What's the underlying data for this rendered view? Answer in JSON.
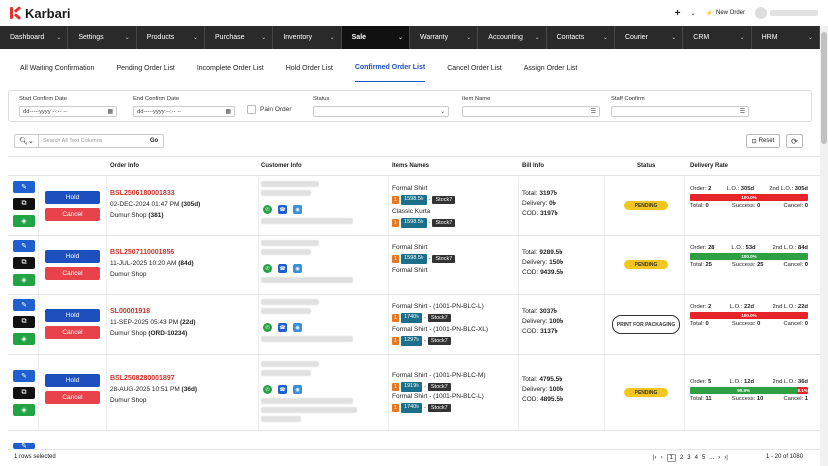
{
  "app": {
    "name": "Karbari"
  },
  "topbar": {
    "plus": "+",
    "new_order": "New Order"
  },
  "nav": [
    "Dashboard",
    "Settings",
    "Products",
    "Purchase",
    "Inventory",
    "Sale",
    "Warranty",
    "Accounting",
    "Contacts",
    "Courier",
    "CRM",
    "HRM"
  ],
  "nav_active": "Sale",
  "tabs": [
    "All Waiting Confirmation",
    "Pending Order List",
    "Incomplete Order List",
    "Hold Order List",
    "Confirmed Order List",
    "Cancel Order List",
    "Assign Order List"
  ],
  "tab_active": "Confirmed Order List",
  "filters": {
    "start_confirm_label": "Start Confirm Date",
    "start_confirm_value": "dd-----yyyy --:-- --",
    "end_confirm_label": "End Confirm Date",
    "end_confirm_value": "dd-----yyyy --:-- --",
    "pain_order_label": "Pain Order",
    "status_label": "Status",
    "item_name_label": "Item Name",
    "staff_confirm_label": "Staff Confirm"
  },
  "search": {
    "placeholder": "Search All Text Columns",
    "go": "Go"
  },
  "reset": "Reset",
  "table_headers": {
    "order_info": "Order Info",
    "customer_info": "Customer Info",
    "items_names": "Items Names",
    "bill_info": "Bill Info",
    "status": "Status",
    "delivery_rate": "Delivery Rate"
  },
  "rows": [
    {
      "hold": "Hold",
      "cancel": "Cancel",
      "order_id": "BSL2506180001833",
      "date": "02-DEC-2024 01:47 PM",
      "days": "(305d)",
      "shop": "Dumur Shop",
      "shop_ref": "(381)",
      "items": [
        {
          "name": "Formal Shirt",
          "qty": "1",
          "price": "1598.5৳",
          "stock": "Stock7"
        },
        {
          "name": "Classic Kurta",
          "qty": "1",
          "price": "1598.5৳",
          "stock": "Stock7"
        }
      ],
      "bill": {
        "total_label": "Total:",
        "total": "3197৳",
        "delivery_label": "Delivery:",
        "delivery": "0৳",
        "cod_label": "COD:",
        "cod": "3197৳"
      },
      "status": "PENDING",
      "delivery": {
        "order": "2",
        "lo": "305d",
        "lo2": "305d",
        "bars": [
          {
            "label": "100.0%",
            "fraction": 1.0,
            "color": "#e8242b"
          }
        ],
        "total": "0",
        "success": "0",
        "cancel": "0"
      }
    },
    {
      "hold": "Hold",
      "cancel": "Cancel",
      "order_id": "BSL2507110001856",
      "date": "11-JUL-2025 10:20 AM",
      "days": "(84d)",
      "shop": "Dumur Shop",
      "shop_ref": "",
      "items": [
        {
          "name": "Formal Shirt",
          "qty": "1",
          "price": "1598.5৳",
          "stock": "Stock7"
        },
        {
          "name": "Formal Shirt",
          "qty": "",
          "price": "",
          "stock": ""
        }
      ],
      "bill": {
        "total_label": "Total:",
        "total": "9289.5৳",
        "delivery_label": "Delivery:",
        "delivery": "150৳",
        "cod_label": "COD:",
        "cod": "9439.5৳"
      },
      "status": "PENDING",
      "delivery": {
        "order": "28",
        "lo": "53d",
        "lo2": "84d",
        "bars": [
          {
            "label": "100.0%",
            "fraction": 1.0,
            "color": "#2ea043"
          }
        ],
        "total": "25",
        "success": "25",
        "cancel": "0"
      }
    },
    {
      "hold": "Hold",
      "cancel": "Cancel",
      "order_id": "SL00001918",
      "date": "11-SEP-2025 05:43 PM",
      "days": "(22d)",
      "shop": "Dumur Shop",
      "shop_ref": "(ORD-10234)",
      "items": [
        {
          "name": "Formal Shirt - (1001-PN-BLC-L)",
          "qty": "1",
          "price": "1740৳",
          "stock": "Stock7"
        },
        {
          "name": "Formal Shirt - (1001-PN-BLC-XL)",
          "qty": "1",
          "price": "1297৳",
          "stock": "Stock7"
        }
      ],
      "bill": {
        "total_label": "Total:",
        "total": "3037৳",
        "delivery_label": "Delivery:",
        "delivery": "100৳",
        "cod_label": "COD:",
        "cod": "3137৳"
      },
      "status": "PRINT FOR PACKAGING",
      "delivery": {
        "order": "2",
        "lo": "22d",
        "lo2": "22d",
        "bars": [
          {
            "label": "100.0%",
            "fraction": 1.0,
            "color": "#e8242b"
          }
        ],
        "total": "0",
        "success": "0",
        "cancel": "0"
      }
    },
    {
      "hold": "Hold",
      "cancel": "Cancel",
      "order_id": "BSL2508280001897",
      "date": "28-AUG-2025 10:51 PM",
      "days": "(36d)",
      "shop": "Dumur Shop",
      "shop_ref": "",
      "items": [
        {
          "name": "Formal Shirt - (1001-PN-BLC-M)",
          "qty": "1",
          "price": "1919৳",
          "stock": "Stock7"
        },
        {
          "name": "Formal Shirt - (1001-PN-BLC-L)",
          "qty": "1",
          "price": "1740৳",
          "stock": "Stock7"
        }
      ],
      "bill": {
        "total_label": "Total:",
        "total": "4795.5৳",
        "delivery_label": "Delivery:",
        "delivery": "100৳",
        "cod_label": "COD:",
        "cod": "4895.5৳"
      },
      "status": "PENDING",
      "delivery": {
        "order": "5",
        "lo": "12d",
        "lo2": "36d",
        "bars": [
          {
            "label": "90.9%",
            "fraction": 0.909,
            "color": "#2ea043"
          },
          {
            "label": "9.1%",
            "fraction": 0.091,
            "color": "#e8242b"
          }
        ],
        "total": "11",
        "success": "10",
        "cancel": "1"
      }
    }
  ],
  "labels": {
    "order": "Order:",
    "lo": "L.O.:",
    "lo2": "2nd L.O.:",
    "total": "Total:",
    "success": "Success:",
    "cancel": "Cancel:"
  },
  "footer": {
    "selected": "1 rows selected",
    "pages": [
      "1",
      "2",
      "3",
      "4",
      "5",
      "..."
    ],
    "range": "1 - 20 of 1080"
  },
  "colors": {
    "accent": "#1f4fbf",
    "danger": "#e8424a",
    "nav_bg": "#2a2a2a"
  }
}
